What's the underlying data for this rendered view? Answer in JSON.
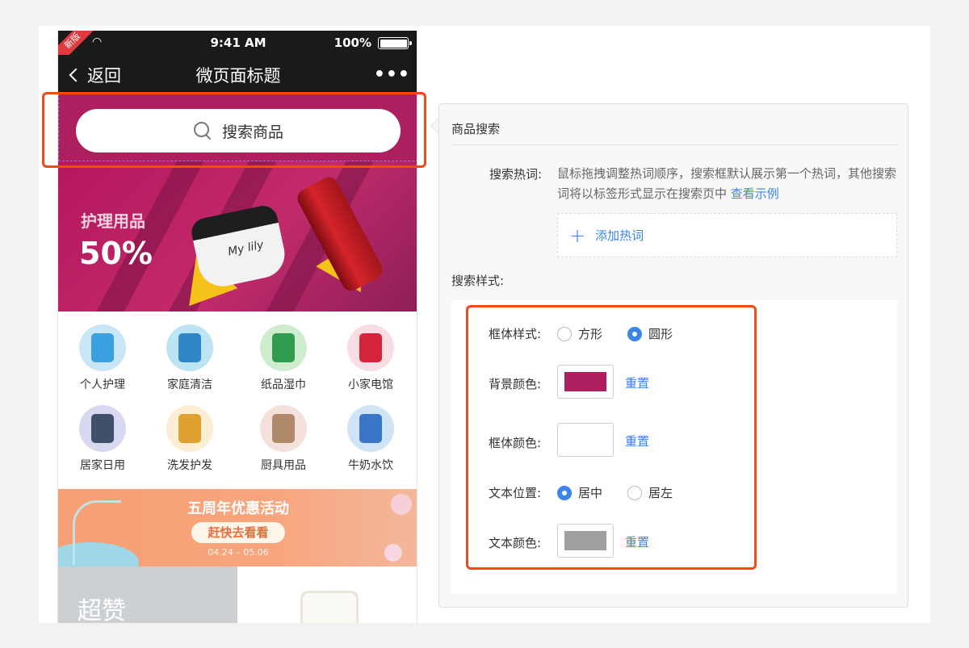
{
  "phone": {
    "ribbon": "新版",
    "time": "9:41 AM",
    "battery": "100%",
    "back_label": "返回",
    "title": "微页面标题",
    "more": "•••",
    "search_placeholder": "搜索商品",
    "search_bg_color": "#ad1f5f",
    "banner": {
      "title": "护理用品",
      "value": "50%",
      "jar_text": "My lily"
    },
    "categories": [
      {
        "label": "个人护理",
        "icon": "personal-care-icon",
        "bg": "#c9e6f7",
        "prod": "#3aa0e0"
      },
      {
        "label": "家庭清洁",
        "icon": "household-cleaning-icon",
        "bg": "#bde4f3",
        "prod": "#2f86c8"
      },
      {
        "label": "纸品湿巾",
        "icon": "paper-wipes-icon",
        "bg": "#cfeccf",
        "prod": "#2f9c4f"
      },
      {
        "label": "小家电馆",
        "icon": "small-appliance-icon",
        "bg": "#f7dde4",
        "prod": "#d4243c"
      },
      {
        "label": "居家日用",
        "icon": "home-daily-icon",
        "bg": "#d9d8f1",
        "prod": "#40506a"
      },
      {
        "label": "洗发护发",
        "icon": "hair-care-icon",
        "bg": "#fbeed4",
        "prod": "#e0a22e"
      },
      {
        "label": "厨具用品",
        "icon": "kitchenware-icon",
        "bg": "#f5e1dc",
        "prod": "#b08a6a"
      },
      {
        "label": "牛奶水饮",
        "icon": "milk-drinks-icon",
        "bg": "#cfe5f5",
        "prod": "#3a76c7"
      }
    ],
    "promo": {
      "title": "五周年优惠活动",
      "button": "赶快去看看",
      "date": "04.24 – 05.06"
    },
    "bottom_left_text": "超赞"
  },
  "panel": {
    "title": "商品搜索",
    "hot_words_label": "搜索热词:",
    "hot_words_desc": "鼠标拖拽调整热词顺序，搜索框默认展示第一个热词，其他搜索词将以标签形式显示在搜索页中",
    "view_example": "查看示例",
    "add_hot_word": "添加热词",
    "search_style_label": "搜索样式:",
    "box_style": {
      "label": "框体样式:",
      "options": [
        "方形",
        "圆形"
      ],
      "selected": "圆形"
    },
    "bg_color": {
      "label": "背景颜色:",
      "value": "#ad1f5f",
      "reset": "重置"
    },
    "box_color": {
      "label": "框体颜色:",
      "value": "#ffffff",
      "reset": "重置"
    },
    "text_position": {
      "label": "文本位置:",
      "options": [
        "居中",
        "居左"
      ],
      "selected": "居中"
    },
    "text_color": {
      "label": "文本颜色:",
      "value": "#a0a0a0",
      "reset": "重置"
    }
  },
  "colors": {
    "accent": "#3b84e8",
    "highlight": "#f04a18"
  }
}
